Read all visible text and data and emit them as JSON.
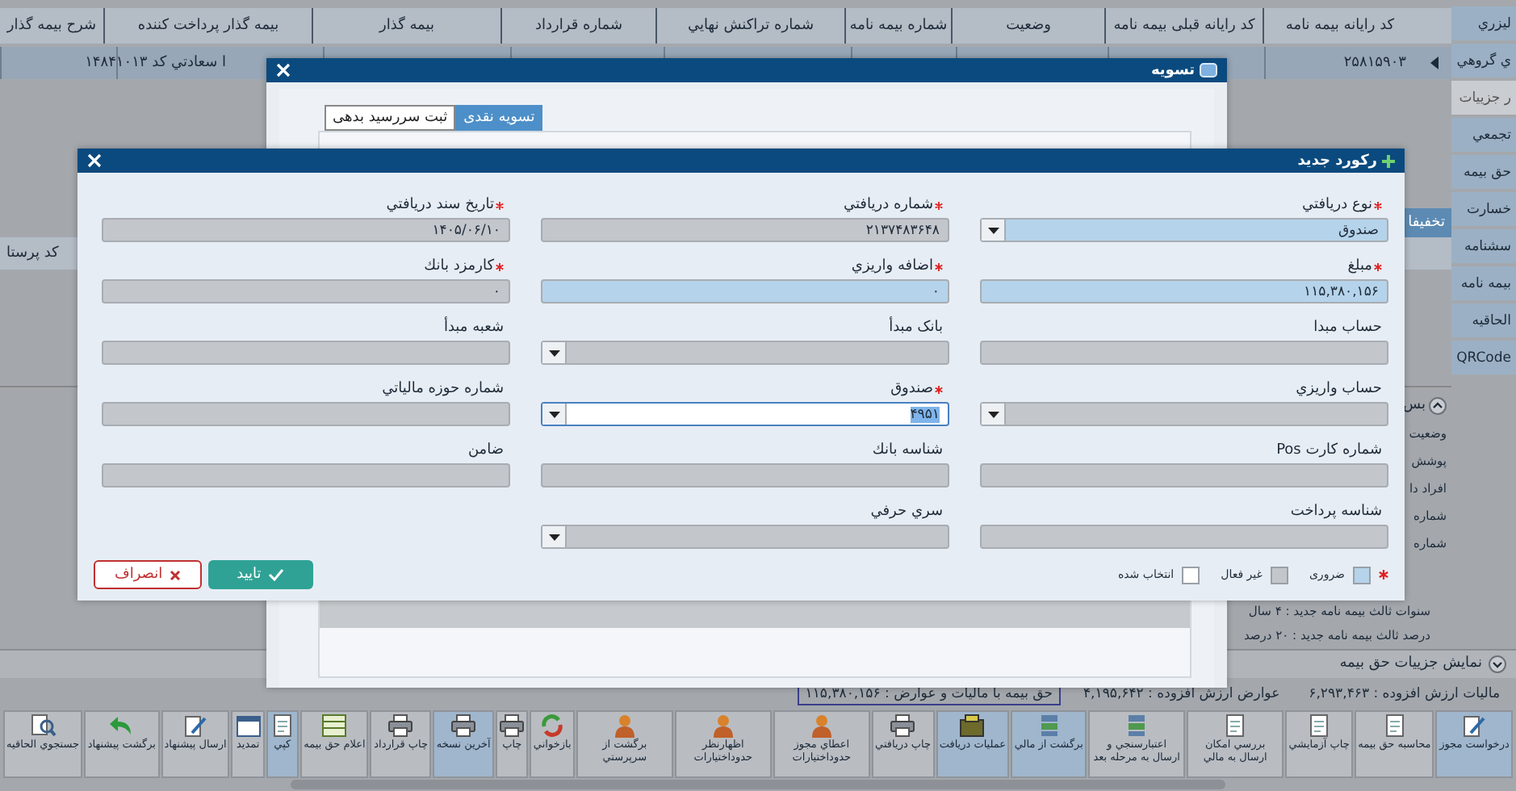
{
  "sidebar": {
    "items": [
      {
        "label": "ليزري",
        "selected": false
      },
      {
        "label": "ي گروهي",
        "selected": false
      },
      {
        "label": "ر جزييات",
        "selected": true
      },
      {
        "label": "تجمعي",
        "selected": false
      },
      {
        "label": "حق بيمه",
        "selected": false
      },
      {
        "label": "خسارت",
        "selected": false
      },
      {
        "label": "سشنامه",
        "selected": false
      },
      {
        "label": "بيمه نامه",
        "selected": false
      },
      {
        "label": "الحاقيه",
        "selected": false
      },
      {
        "label": "QRCode",
        "selected": false
      }
    ]
  },
  "table": {
    "columns": [
      "کد رايانه بيمه نامه",
      "کد رايانه قبلی بيمه نامه",
      "وضعيت",
      "شماره بيمه نامه",
      "شماره تراکنش نهايي",
      "شماره قرارداد",
      "بيمه گذار",
      "بيمه گذار پرداخت کننده",
      "شرح بيمه گذار"
    ],
    "rows": [
      {
        "policy_code": "۲۵۸۱۵۹۰۳",
        "payer": "ا سعادتي کد ۱۴۸۴۱۰۱۳"
      }
    ]
  },
  "discount_tab": {
    "label": "تخفيفا"
  },
  "sub_table": {
    "columns": [
      "کد پرستا"
    ]
  },
  "details_panel": {
    "title": "بس",
    "lines": [
      "وضعيت",
      "پوشش",
      "افراد دا",
      "شماره",
      "شماره"
    ],
    "summary": [
      "سنوات ثالث بيمه نامه جديد : ۴ سال",
      "درصد ثالث بيمه نامه جديد : ۲۰ درصد"
    ]
  },
  "premium_details": {
    "title": "نمايش جزييات حق بيمه",
    "totals": [
      {
        "text": "ماليات ارزش افزوده : ۶,۲۹۳,۴۶۳",
        "boxed": false
      },
      {
        "text": "عوارض ارزش افزوده : ۴,۱۹۵,۶۴۲",
        "boxed": false
      },
      {
        "text": "حق بيمه با ماليات و عوارض : ۱۱۵,۳۸۰,۱۵۶",
        "boxed": true
      }
    ]
  },
  "toolbar": {
    "buttons": [
      {
        "label": "درخواست مجوز",
        "active": true
      },
      {
        "label": "محاسبه حق بيمه",
        "active": false
      },
      {
        "label": "چاپ آزمايشي",
        "active": false
      },
      {
        "label": "بررسي امكان ارسال به مالي",
        "active": false
      },
      {
        "label": "اعتبارسنجي و ارسال به مرحله بعد",
        "active": false
      },
      {
        "label": "برگشت از مالي",
        "active": true
      },
      {
        "label": "عمليات دريافت",
        "active": true
      },
      {
        "label": "چاپ دريافتي",
        "active": false
      },
      {
        "label": "اعطاي مجوز حدوداختيارات",
        "active": false
      },
      {
        "label": "اظهارنظر حدوداختيارات",
        "active": false
      },
      {
        "label": "برگشت از سرپرستي",
        "active": false
      },
      {
        "label": "بازخواني",
        "active": false
      },
      {
        "label": "چاپ",
        "active": false
      },
      {
        "label": "آخرين نسخه",
        "active": true
      },
      {
        "label": "چاپ قرارداد",
        "active": false
      },
      {
        "label": "اعلام حق بيمه",
        "active": false
      },
      {
        "label": "کپي",
        "active": true
      },
      {
        "label": "تمديد",
        "active": false
      },
      {
        "label": "ارسال پيشنهاد",
        "active": false
      },
      {
        "label": "برگشت پيشنهاد",
        "active": false
      },
      {
        "label": "جستجوي الحاقيه",
        "active": false
      }
    ]
  },
  "settlement_dialog": {
    "title": "تسويه",
    "tabs": [
      {
        "label": "تسويه نقدی",
        "selected": true
      },
      {
        "label": "ثبت سررسيد بدهی",
        "selected": false
      }
    ]
  },
  "record_dialog": {
    "title": "رکورد جديد",
    "fields": [
      {
        "label": "نوع دريافتي",
        "value": "صندوق",
        "kind": "combo",
        "disabled": false,
        "selected": false,
        "required": true
      },
      {
        "label": "شماره دريافتي",
        "value": "۲۱۳۷۴۸۳۶۴۸",
        "kind": "text",
        "disabled": true,
        "selected": false,
        "required": true
      },
      {
        "label": "تاريخ سند دريافتي",
        "value": "۱۴۰۵/۰۶/۱۰",
        "kind": "text",
        "disabled": true,
        "selected": false,
        "required": true
      },
      {
        "label": "مبلغ",
        "value": "۱۱۵,۳۸۰,۱۵۶",
        "kind": "text",
        "disabled": false,
        "selected": false,
        "required": true
      },
      {
        "label": "اضافه واريزي",
        "value": "۰",
        "kind": "text",
        "disabled": false,
        "selected": false,
        "required": true
      },
      {
        "label": "کارمزد بانك",
        "value": "۰",
        "kind": "text",
        "disabled": true,
        "selected": false,
        "required": true
      },
      {
        "label": "حساب مبدا",
        "kind": "text",
        "disabled": true,
        "selected": false,
        "required": false
      },
      {
        "label": "بانک مبدأ",
        "kind": "combo",
        "disabled": true,
        "selected": false,
        "required": false
      },
      {
        "label": "شعبه مبدأ",
        "kind": "text",
        "disabled": true,
        "selected": false,
        "required": false
      },
      {
        "label": "حساب واريزي",
        "kind": "combo",
        "disabled": true,
        "selected": false,
        "required": false
      },
      {
        "label": "صندوق",
        "value": "۴۹۵۱",
        "kind": "combo",
        "disabled": false,
        "selected": true,
        "required": true
      },
      {
        "label": "شماره حوزه مالياتي",
        "kind": "text",
        "disabled": true,
        "selected": false,
        "required": false
      },
      {
        "label": "شماره کارت Pos",
        "kind": "text",
        "disabled": true,
        "selected": false,
        "required": false
      },
      {
        "label": "شناسه بانك",
        "kind": "text",
        "disabled": true,
        "selected": false,
        "required": false
      },
      {
        "label": "ضامن",
        "kind": "text",
        "disabled": true,
        "selected": false,
        "required": false
      },
      {
        "label": "شناسه پرداخت",
        "kind": "text",
        "disabled": true,
        "selected": false,
        "required": false
      },
      {
        "label": "سري حرفي",
        "kind": "combo",
        "disabled": true,
        "selected": false,
        "required": false
      }
    ],
    "legend": [
      {
        "label": "ضروری",
        "kind": "required"
      },
      {
        "label": "غیر فعال",
        "kind": "disabled"
      },
      {
        "label": "انتخاب شده",
        "kind": "selected"
      }
    ],
    "buttons": [
      {
        "label": "تاييد",
        "kind": "confirm"
      },
      {
        "label": "انصراف",
        "kind": "cancel"
      }
    ]
  }
}
